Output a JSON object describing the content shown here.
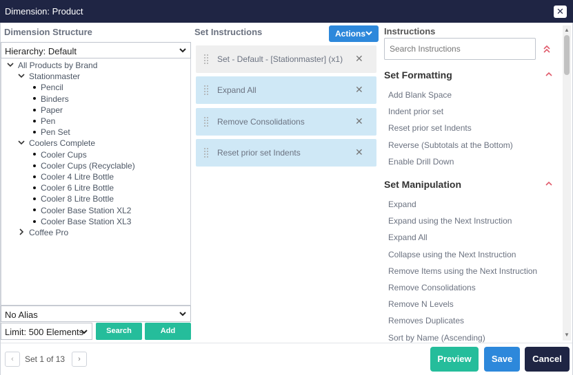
{
  "window": {
    "title": "Dimension: Product",
    "close_icon": "close-icon"
  },
  "left": {
    "heading": "Dimension Structure",
    "hierarchy_select": "Hierarchy: Default",
    "tree": [
      {
        "label": "All Products by Brand",
        "level": 0,
        "state": "expanded"
      },
      {
        "label": "Stationmaster",
        "level": 1,
        "state": "expanded"
      },
      {
        "label": "Pencil",
        "level": 2,
        "state": "leaf"
      },
      {
        "label": "Binders",
        "level": 2,
        "state": "leaf"
      },
      {
        "label": "Paper",
        "level": 2,
        "state": "leaf"
      },
      {
        "label": "Pen",
        "level": 2,
        "state": "leaf"
      },
      {
        "label": "Pen Set",
        "level": 2,
        "state": "leaf"
      },
      {
        "label": "Coolers Complete",
        "level": 1,
        "state": "expanded"
      },
      {
        "label": "Cooler Cups",
        "level": 2,
        "state": "leaf"
      },
      {
        "label": "Cooler Cups (Recyclable)",
        "level": 2,
        "state": "leaf"
      },
      {
        "label": "Cooler 4 Litre Bottle",
        "level": 2,
        "state": "leaf"
      },
      {
        "label": "Cooler 6 Litre Bottle",
        "level": 2,
        "state": "leaf"
      },
      {
        "label": "Cooler 8 Litre Bottle",
        "level": 2,
        "state": "leaf"
      },
      {
        "label": "Cooler Base Station XL2",
        "level": 2,
        "state": "leaf"
      },
      {
        "label": "Cooler Base Station XL3",
        "level": 2,
        "state": "leaf"
      },
      {
        "label": "Coffee Pro",
        "level": 1,
        "state": "collapsed"
      }
    ],
    "alias_select": "No Alias",
    "limit_select": "Limit: 500 Elements",
    "search_button": "Search",
    "add_button": "Add"
  },
  "middle": {
    "heading": "Set Instructions",
    "actions_button": "Actions",
    "instructions": [
      {
        "label": "Set - Default - [Stationmaster] (x1)",
        "style": "gray"
      },
      {
        "label": "Expand All",
        "style": "blue"
      },
      {
        "label": "Remove Consolidations",
        "style": "blue"
      },
      {
        "label": "Reset prior set Indents",
        "style": "blue"
      }
    ]
  },
  "right": {
    "heading": "Instructions",
    "search_placeholder": "Search Instructions",
    "groups": [
      {
        "title": "Set Formatting",
        "items": [
          "Add Blank Space",
          "Indent prior set",
          "Reset prior set Indents",
          "Reverse (Subtotals at the Bottom)",
          "Enable Drill Down"
        ]
      },
      {
        "title": "Set Manipulation",
        "items": [
          "Expand",
          "Expand using the Next Instruction",
          "Expand All",
          "Collapse using the Next Instruction",
          "Remove Items using the Next Instruction",
          "Remove Consolidations",
          "Remove N Levels",
          "Removes Duplicates",
          "Sort by Name (Ascending)"
        ]
      }
    ]
  },
  "footer": {
    "page_text": "Set 1 of 13",
    "preview_button": "Preview",
    "save_button": "Save",
    "cancel_button": "Cancel"
  },
  "colors": {
    "titlebar": "#1f2544",
    "green": "#25bd9b",
    "blue": "#2d88db",
    "instruction_blue": "#cfe8f6",
    "cancel": "#1f2544",
    "accent_red": "#e05a6b"
  }
}
